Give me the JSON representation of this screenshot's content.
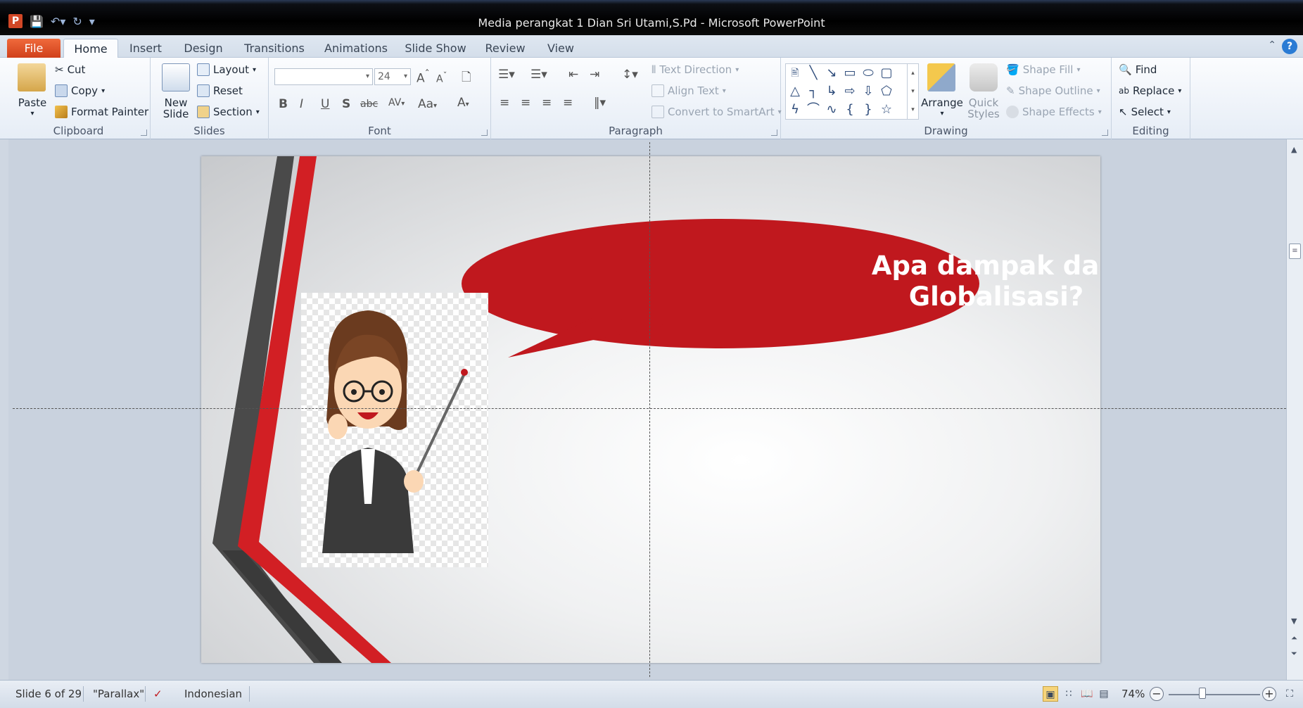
{
  "window": {
    "title": "Media perangkat 1 Dian Sri Utami,S.Pd  -  Microsoft PowerPoint",
    "app_icon": "P"
  },
  "tabs": [
    {
      "label": "File"
    },
    {
      "label": "Home"
    },
    {
      "label": "Insert"
    },
    {
      "label": "Design"
    },
    {
      "label": "Transitions"
    },
    {
      "label": "Animations"
    },
    {
      "label": "Slide Show"
    },
    {
      "label": "Review"
    },
    {
      "label": "View"
    }
  ],
  "ribbon": {
    "clipboard": {
      "label": "Clipboard",
      "paste": "Paste",
      "cut": "Cut",
      "copy": "Copy",
      "format_painter": "Format Painter"
    },
    "slides": {
      "label": "Slides",
      "new_slide_line1": "New",
      "new_slide_line2": "Slide",
      "layout": "Layout",
      "reset": "Reset",
      "section": "Section"
    },
    "font": {
      "label": "Font",
      "font_name": "",
      "font_size": "24",
      "bold": "B",
      "italic": "I",
      "underline": "U",
      "shadow": "S",
      "strike": "abc",
      "spacing": "AV",
      "case": "Aa",
      "color": "A",
      "grow": "A",
      "shrink": "A"
    },
    "paragraph": {
      "label": "Paragraph",
      "text_direction": "Text Direction",
      "align_text": "Align Text",
      "convert_smartart": "Convert to SmartArt"
    },
    "drawing": {
      "label": "Drawing",
      "arrange": "Arrange",
      "quick_styles_line1": "Quick",
      "quick_styles_line2": "Styles",
      "shape_fill": "Shape Fill",
      "shape_outline": "Shape Outline",
      "shape_effects": "Shape Effects"
    },
    "editing": {
      "label": "Editing",
      "find": "Find",
      "replace": "Replace",
      "select": "Select"
    }
  },
  "slide": {
    "bubble_line1": "Apa  dampak dari",
    "bubble_line2": "Globalisasi?",
    "colors": {
      "bubble": "#c0181e",
      "stripe_red": "#d21f24",
      "stripe_gray": "#4a4a4a"
    }
  },
  "status": {
    "slide_info": "Slide 6 of 29",
    "theme": "\"Parallax\"",
    "language": "Indonesian",
    "zoom": "74%",
    "zoom_level": 0.74
  }
}
